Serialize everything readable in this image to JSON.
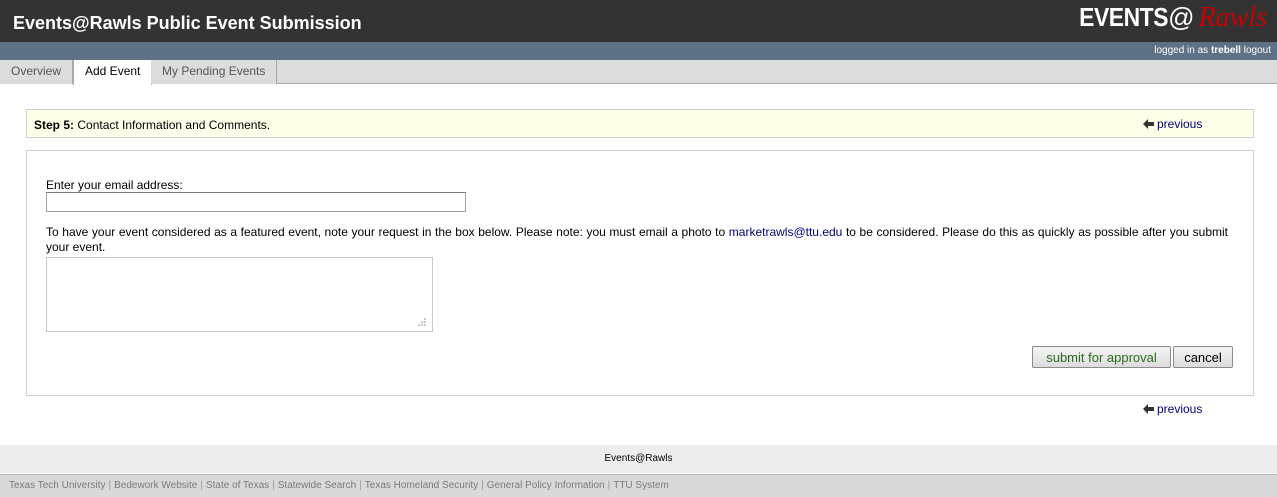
{
  "header": {
    "title": "Events@Rawls Public Event Submission",
    "logo": {
      "part1": "EVENTS",
      "part2": "@",
      "part3": "Rawls"
    }
  },
  "status": {
    "prefix": "logged in as",
    "user": "trebell",
    "logout": "logout"
  },
  "tabs": [
    {
      "label": "Overview"
    },
    {
      "label": "Add Event"
    },
    {
      "label": "My Pending Events"
    }
  ],
  "step": {
    "number": "Step 5:",
    "text": " Contact Information and Comments.",
    "previous": "previous"
  },
  "form": {
    "email_label": "Enter your email address:",
    "email_value": "",
    "note_before": "To have your event considered as a featured event, note your request in the box below. Please note: you must email a photo to ",
    "note_email": "marketrawls@ttu.edu",
    "note_after": " to be considered. Please do this as quickly as possible after you submit your event.",
    "comments_value": "",
    "submit_label": "submit for approval",
    "cancel_label": "cancel"
  },
  "bottom_previous": "previous",
  "footer": {
    "site": "Events@Rawls",
    "links": [
      "Texas Tech University",
      "Bedework Website",
      "State of Texas",
      "Statewide Search",
      "Texas Homeland Security",
      "General Policy Information",
      "TTU System"
    ]
  },
  "colors": {
    "header_bg": "#333333",
    "status_bg": "#5e7185",
    "step_bg": "#ffffe9",
    "logo_accent": "#cc0000",
    "link": "#00007f",
    "submit_text": "#2e6b1e"
  },
  "icons": {
    "previous": "arrow-left-icon",
    "resize": "resize-grip-icon"
  }
}
